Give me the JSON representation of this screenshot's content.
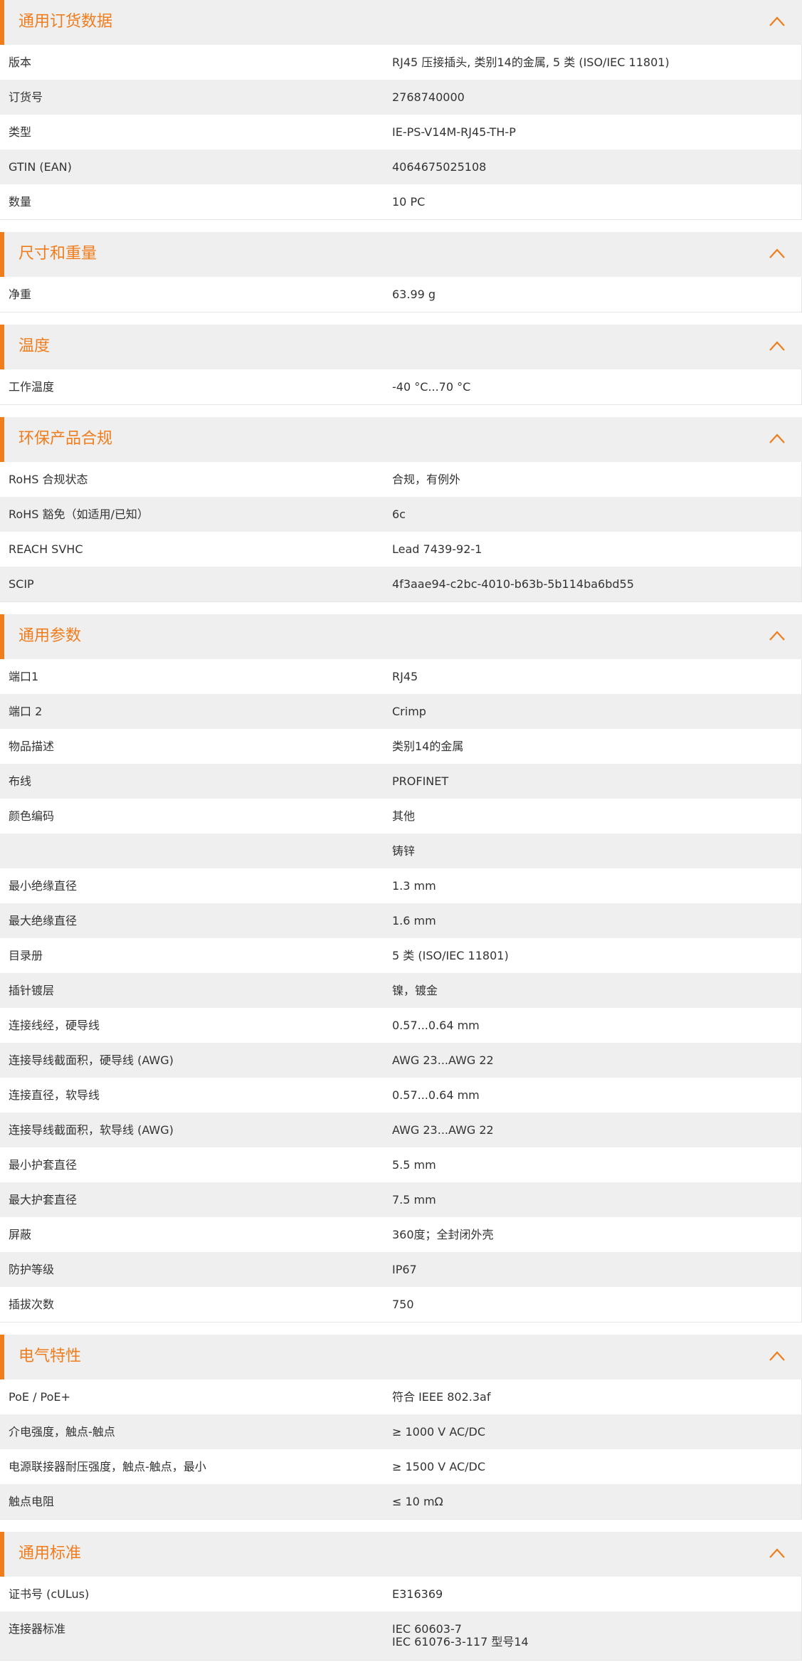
{
  "theme": {
    "accent": "#f07d1d",
    "header_bg": "#efefef",
    "row_alt_bg": "#efefef",
    "icons": {
      "collapse": "chevron-up-icon"
    }
  },
  "sections": [
    {
      "title": "通用订货数据",
      "rows": [
        {
          "label": "版本",
          "value": "RJ45 压接插头, 类别14的金属, 5 类 (ISO/IEC 11801)"
        },
        {
          "label": "订货号",
          "value": "2768740000"
        },
        {
          "label": "类型",
          "value": "IE-PS-V14M-RJ45-TH-P"
        },
        {
          "label": "GTIN (EAN)",
          "value": "4064675025108"
        },
        {
          "label": "数量",
          "value": "10  PC"
        }
      ]
    },
    {
      "title": "尺寸和重量",
      "rows": [
        {
          "label": "净重",
          "value": "63.99  g"
        }
      ]
    },
    {
      "title": "温度",
      "rows": [
        {
          "label": "工作温度",
          "value": "-40 °C...70 °C"
        }
      ]
    },
    {
      "title": "环保产品合规",
      "rows": [
        {
          "label": "RoHS 合规状态",
          "value": "合规，有例外"
        },
        {
          "label": "RoHS 豁免（如适用/已知）",
          "value": "6c"
        },
        {
          "label": "REACH SVHC",
          "value": "Lead 7439-92-1"
        },
        {
          "label": "SCIP",
          "value": "4f3aae94-c2bc-4010-b63b-5b114ba6bd55"
        }
      ]
    },
    {
      "title": "通用参数",
      "rows": [
        {
          "label": "端口1",
          "value": "RJ45"
        },
        {
          "label": "端口 2",
          "value": "Crimp"
        },
        {
          "label": "物品描述",
          "value": "类别14的金属"
        },
        {
          "label": "布线",
          "value": "PROFINET"
        },
        {
          "label": "颜色编码",
          "value": "其他"
        },
        {
          "label": "",
          "value": "铸锌"
        },
        {
          "label": "最小绝缘直径",
          "value": "1.3  mm"
        },
        {
          "label": "最大绝缘直径",
          "value": "1.6  mm"
        },
        {
          "label": "目录册",
          "value": "5 类 (ISO/IEC 11801)"
        },
        {
          "label": "插针镀层",
          "value": "镍，镀金"
        },
        {
          "label": "连接线经，硬导线",
          "value": "0.57...0.64 mm"
        },
        {
          "label": "连接导线截面积，硬导线 (AWG)",
          "value": "AWG 23...AWG 22"
        },
        {
          "label": "连接直径，软导线",
          "value": "0.57...0.64 mm"
        },
        {
          "label": "连接导线截面积，软导线 (AWG)",
          "value": "AWG 23...AWG 22"
        },
        {
          "label": "最小护套直径",
          "value": "5.5  mm"
        },
        {
          "label": "最大护套直径",
          "value": "7.5  mm"
        },
        {
          "label": "屏蔽",
          "value": "360度；全封闭外壳"
        },
        {
          "label": "防护等级",
          "value": "IP67"
        },
        {
          "label": "插拔次数",
          "value": "750"
        }
      ]
    },
    {
      "title": "电气特性",
      "rows": [
        {
          "label": "PoE / PoE+",
          "value": "符合 IEEE 802.3af"
        },
        {
          "label": "介电强度，触点-触点",
          "value": "≥ 1000 V AC/DC"
        },
        {
          "label": "电源联接器耐压强度，触点-触点，最小",
          "value": "≥ 1500 V AC/DC"
        },
        {
          "label": "触点电阻",
          "value": "≤ 10 mΩ"
        }
      ]
    },
    {
      "title": "通用标准",
      "rows": [
        {
          "label": "证书号 (cULus)",
          "value": "E316369"
        },
        {
          "label": "连接器标准",
          "value_lines": [
            "IEC 60603-7",
            "IEC 61076-3-117 型号14"
          ]
        }
      ]
    }
  ]
}
